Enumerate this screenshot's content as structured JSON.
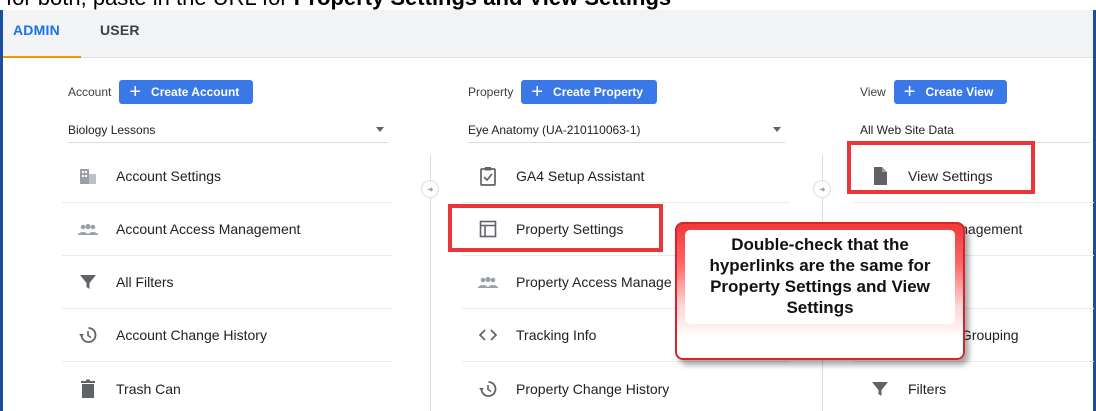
{
  "caption": {
    "prefix": "for both, paste in the URL for ",
    "bold": "Property Settings and View Settings"
  },
  "tabs": {
    "admin": "ADMIN",
    "user": "USER"
  },
  "account": {
    "label": "Account",
    "create_label": "Create Account",
    "selected": "Biology Lessons",
    "items": [
      {
        "label": "Account Settings",
        "icon": "building-icon"
      },
      {
        "label": "Account Access Management",
        "icon": "people-icon"
      },
      {
        "label": "All Filters",
        "icon": "filter-icon"
      },
      {
        "label": "Account Change History",
        "icon": "history-icon"
      },
      {
        "label": "Trash Can",
        "icon": "trash-icon"
      }
    ]
  },
  "property": {
    "label": "Property",
    "create_label": "Create Property",
    "selected": "Eye Anatomy (UA-210110063-1)",
    "items": [
      {
        "label": "GA4 Setup Assistant",
        "icon": "clipboard-check-icon"
      },
      {
        "label": "Property Settings",
        "icon": "window-icon"
      },
      {
        "label": "Property Access Manage",
        "icon": "people-icon"
      },
      {
        "label": "Tracking Info",
        "icon": "code-icon"
      },
      {
        "label": "Property Change History",
        "icon": "history-icon"
      }
    ]
  },
  "view": {
    "label": "View",
    "create_label": "Create View",
    "selected": "All Web Site Data",
    "items": [
      {
        "label": "View Settings",
        "icon": "document-icon"
      },
      {
        "label": "cess Management",
        "icon": "people-icon"
      },
      {
        "label": "",
        "icon": "goal-icon"
      },
      {
        "label": "Content Grouping",
        "icon": "grouping-icon"
      },
      {
        "label": "Filters",
        "icon": "filter-icon"
      }
    ]
  },
  "callout": {
    "text": "Double-check that the hyperlinks are the same for Property Settings and View Settings"
  },
  "colors": {
    "accent_blue": "#1a73e8",
    "button_blue": "#3b78e7",
    "tab_underline": "#f29900",
    "highlight_red": "#e8363a"
  }
}
